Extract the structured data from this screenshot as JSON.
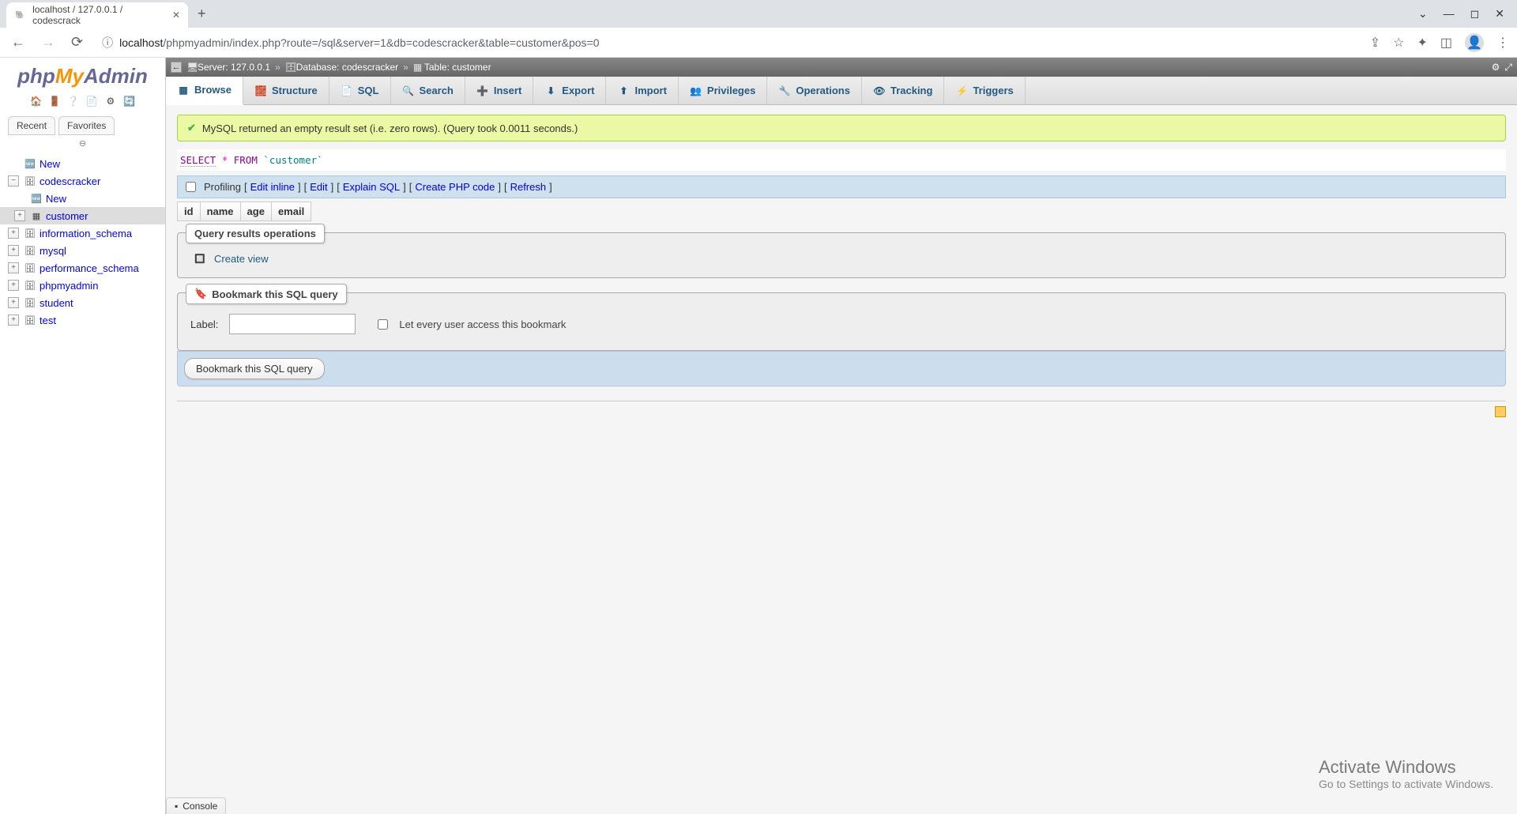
{
  "browser": {
    "tab_title": "localhost / 127.0.0.1 / codescrack",
    "url_prefix": "localhost",
    "url_path": "/phpmyadmin/index.php?route=/sql&server=1&db=codescracker&table=customer&pos=0"
  },
  "logo": {
    "php": "php",
    "my": "My",
    "admin": "Admin"
  },
  "sidebar_tabs": {
    "recent": "Recent",
    "favorites": "Favorites"
  },
  "tree": {
    "new": "New",
    "db_codescracker": "codescracker",
    "db_codescracker_new": "New",
    "db_codescracker_customer": "customer",
    "db_information_schema": "information_schema",
    "db_mysql": "mysql",
    "db_performance_schema": "performance_schema",
    "db_phpmyadmin": "phpmyadmin",
    "db_student": "student",
    "db_test": "test"
  },
  "breadcrumb": {
    "server_label": "Server:",
    "server_value": "127.0.0.1",
    "database_label": "Database:",
    "database_value": "codescracker",
    "table_label": "Table:",
    "table_value": "customer",
    "sep": "»"
  },
  "tabs": {
    "browse": "Browse",
    "structure": "Structure",
    "sql": "SQL",
    "search": "Search",
    "insert": "Insert",
    "export": "Export",
    "import": "Import",
    "privileges": "Privileges",
    "operations": "Operations",
    "tracking": "Tracking",
    "triggers": "Triggers"
  },
  "success_msg": "MySQL returned an empty result set (i.e. zero rows). (Query took 0.0011 seconds.)",
  "sql": {
    "select": "SELECT",
    "star": "*",
    "from": "FROM",
    "table": "`customer`"
  },
  "actions": {
    "profiling": "Profiling",
    "edit_inline": "Edit inline",
    "edit": "Edit",
    "explain_sql": "Explain SQL",
    "create_php": "Create PHP code",
    "refresh": "Refresh"
  },
  "columns": [
    "id",
    "name",
    "age",
    "email"
  ],
  "qro_legend": "Query results operations",
  "create_view": "Create view",
  "bookmark_legend": "Bookmark this SQL query",
  "bookmark": {
    "label": "Label:",
    "let_every_user": "Let every user access this bookmark",
    "submit": "Bookmark this SQL query"
  },
  "console": "Console",
  "watermark": {
    "title": "Activate Windows",
    "sub": "Go to Settings to activate Windows."
  }
}
